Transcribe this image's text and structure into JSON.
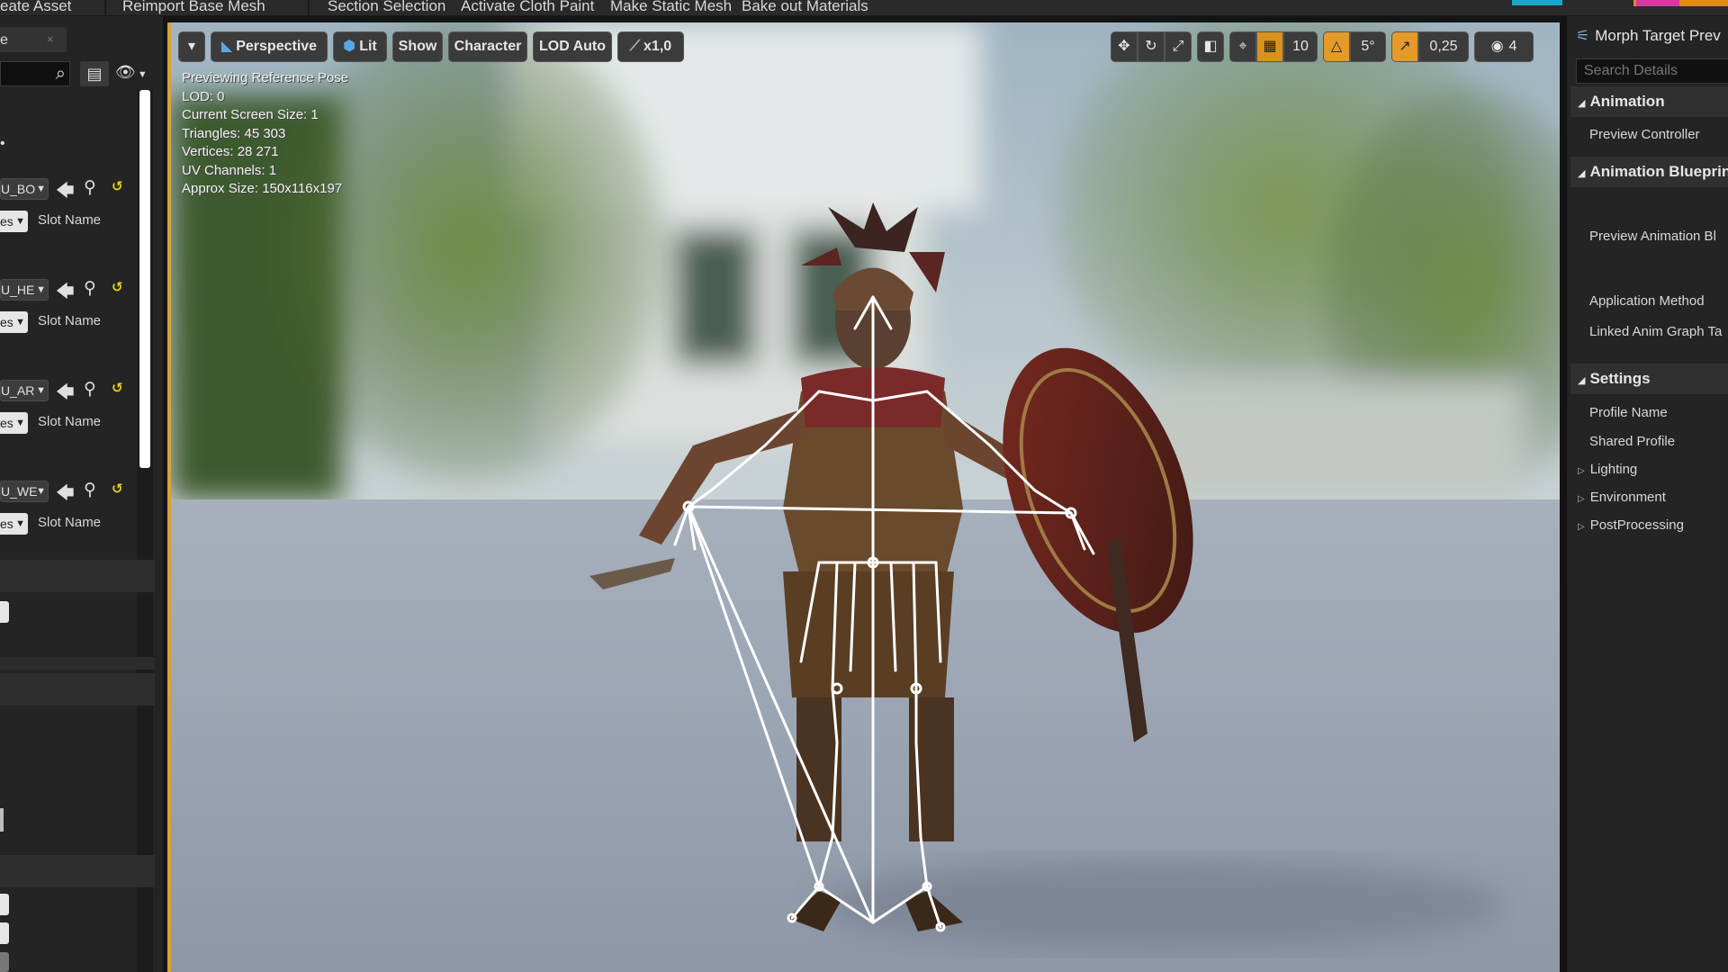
{
  "toolbar": {
    "items": [
      "eate Asset",
      "Reimport Base Mesh",
      "Section Selection",
      "Activate Cloth Paint",
      "Make Static Mesh",
      "Bake out Materials"
    ]
  },
  "left_panel": {
    "tab_label": "e",
    "tab_close": "×",
    "materials": [
      {
        "name": "U_BO",
        "slot_value": "es",
        "slot_label": "Slot Name"
      },
      {
        "name": "U_HE",
        "slot_value": "es",
        "slot_label": "Slot Name"
      },
      {
        "name": "U_AR",
        "slot_value": "es",
        "slot_label": "Slot Name"
      },
      {
        "name": "U_WE",
        "slot_value": "es",
        "slot_label": "Slot Name"
      }
    ]
  },
  "viewport": {
    "toolbar": {
      "menu_glyph": "▾",
      "perspective": "Perspective",
      "lit": "Lit",
      "show": "Show",
      "character": "Character",
      "lod": "LOD Auto",
      "speed": "x1,0",
      "grid_snap": "10",
      "rotation_snap": "5°",
      "scale_snap": "0,25",
      "camera_speed": "4"
    },
    "stats": [
      "Previewing Reference Pose",
      "LOD: 0",
      "Current Screen Size: 1",
      "Triangles: 45 303",
      "Vertices: 28 271",
      "UV Channels: 1",
      "Approx Size: 150x116x197"
    ]
  },
  "right_panel": {
    "title": "Morph Target Prev",
    "search_placeholder": "Search Details",
    "categories": {
      "animation": "Animation",
      "animation_blueprint": "Animation Blueprint",
      "settings": "Settings"
    },
    "items": {
      "preview_controller": "Preview Controller",
      "preview_animation": "Preview Animation Bl",
      "application_method": "Application Method",
      "linked_anim_graph": "Linked Anim Graph Ta",
      "profile_name": "Profile Name",
      "shared_profile": "Shared Profile",
      "lighting": "Lighting",
      "environment": "Environment",
      "postprocessing": "PostProcessing"
    }
  },
  "colors": {
    "accent_orange": "#e39a2b",
    "viewport_border": "#d8a23a",
    "reset_yellow": "#e8d21a",
    "accent_cyan": "#1aa6c9",
    "accent_pink": "#d43aa0"
  }
}
